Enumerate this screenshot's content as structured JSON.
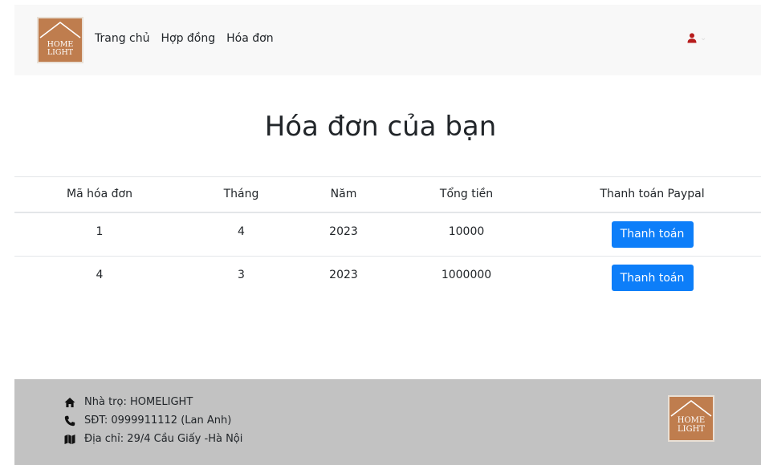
{
  "brand": {
    "logo_line1": "HOME",
    "logo_line2": "LIGHT",
    "color": "#bf7d4e"
  },
  "nav": {
    "items": [
      {
        "label": "Trang chủ"
      },
      {
        "label": "Hợp đồng"
      },
      {
        "label": "Hóa đơn"
      }
    ],
    "user_icon": "user-icon",
    "user_icon_color": "#b71c1c"
  },
  "page": {
    "title": "Hóa đơn của bạn"
  },
  "table": {
    "headers": [
      "Mã hóa đơn",
      "Tháng",
      "Năm",
      "Tổng tiền",
      "Thanh toán Paypal"
    ],
    "rows": [
      {
        "id": "1",
        "month": "4",
        "year": "2023",
        "total": "10000",
        "action": "Thanh toán"
      },
      {
        "id": "4",
        "month": "3",
        "year": "2023",
        "total": "1000000",
        "action": "Thanh toán"
      }
    ],
    "button_color": "#0d7ef9"
  },
  "footer": {
    "name": "Nhà trọ: HOMELIGHT",
    "phone": "SĐT: 0999911112 (Lan Anh)",
    "address": "Địa chỉ: 29/4 Cầu Giấy -Hà Nội",
    "icons": [
      "home-icon",
      "phone-icon",
      "map-icon"
    ],
    "background": "#c2c2c2"
  }
}
